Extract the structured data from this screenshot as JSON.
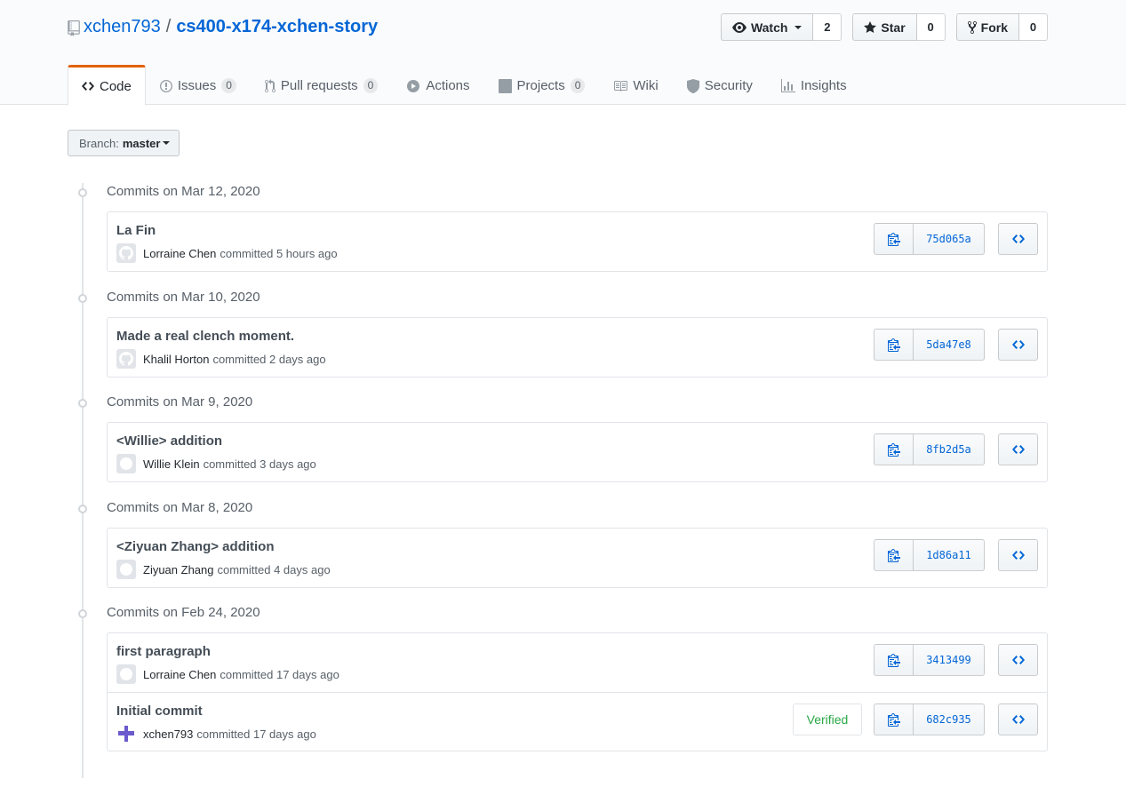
{
  "repo": {
    "owner": "xchen793",
    "separator": "/",
    "name": "cs400-x174-xchen-story"
  },
  "actions": {
    "watch": {
      "label": "Watch",
      "count": "2"
    },
    "star": {
      "label": "Star",
      "count": "0"
    },
    "fork": {
      "label": "Fork",
      "count": "0"
    }
  },
  "nav": [
    {
      "label": "Code",
      "icon": "code-icon"
    },
    {
      "label": "Issues",
      "counter": "0",
      "icon": "issue-icon"
    },
    {
      "label": "Pull requests",
      "counter": "0",
      "icon": "pull-request-icon"
    },
    {
      "label": "Actions",
      "icon": "play-icon"
    },
    {
      "label": "Projects",
      "counter": "0",
      "icon": "project-icon"
    },
    {
      "label": "Wiki",
      "icon": "book-icon"
    },
    {
      "label": "Security",
      "icon": "shield-icon"
    },
    {
      "label": "Insights",
      "icon": "graph-icon"
    }
  ],
  "branch": {
    "label": "Branch:",
    "value": "master"
  },
  "groups": [
    {
      "title": "Commits on Mar 12, 2020",
      "commits": [
        {
          "message": "La Fin",
          "author": "Lorraine Chen",
          "time": "committed 5 hours ago",
          "sha": "75d065a"
        }
      ]
    },
    {
      "title": "Commits on Mar 10, 2020",
      "commits": [
        {
          "message": "Made a real clench moment.",
          "author": "Khalil Horton",
          "time": "committed 2 days ago",
          "sha": "5da47e8"
        }
      ]
    },
    {
      "title": "Commits on Mar 9, 2020",
      "commits": [
        {
          "message": "<Willie> addition",
          "author": "Willie Klein",
          "time": "committed 3 days ago",
          "sha": "8fb2d5a"
        }
      ]
    },
    {
      "title": "Commits on Mar 8, 2020",
      "commits": [
        {
          "message": "<Ziyuan Zhang> addition",
          "author": "Ziyuan Zhang",
          "time": "committed 4 days ago",
          "sha": "1d86a11"
        }
      ]
    },
    {
      "title": "Commits on Feb 24, 2020",
      "commits": [
        {
          "message": "first paragraph",
          "author": "Lorraine Chen",
          "time": "committed 17 days ago",
          "sha": "3413499"
        },
        {
          "message": "Initial commit",
          "author": "xchen793",
          "time": "committed 17 days ago",
          "sha": "682c935",
          "verified": "Verified"
        }
      ]
    }
  ]
}
